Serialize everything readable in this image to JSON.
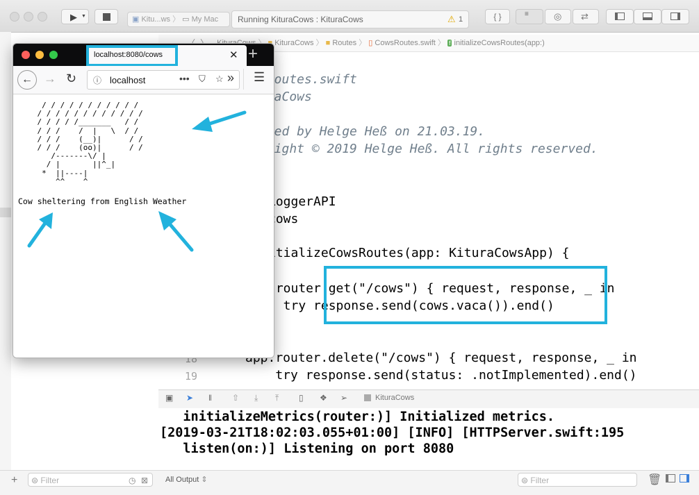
{
  "toolbar": {
    "scheme_target": "Kitu...ws",
    "scheme_device": "My Mac",
    "activity_text": "Running KituraCows : KituraCows",
    "warning_count": "1"
  },
  "jumpbar": {
    "crumbs": [
      "KituraCows",
      "KituraCows",
      "Routes",
      "CowsRoutes.swift",
      "initializeCowsRoutes(app:)"
    ]
  },
  "editor": {
    "lines": [
      {
        "num": "",
        "text": "sRoutes.swift"
      },
      {
        "num": "",
        "text": "uraCows"
      },
      {
        "num": "",
        "text": "ated by Helge Heß on 21.03.19."
      },
      {
        "num": "",
        "text": "yright © 2019 Helge Heß. All rights reserved."
      },
      {
        "num": "",
        "text": "LoggerAPI"
      },
      {
        "num": "",
        "text": "cows"
      },
      {
        "num": "",
        "text": "itializeCowsRoutes(app: KituraCowsApp) {"
      },
      {
        "num": "",
        "text": ".router.get(\"/cows\") { request, response, _ in"
      },
      {
        "num": "",
        "text": "  try response.send(cows.vaca()).end()"
      },
      {
        "num": "18",
        "text": "app.router.delete(\"/cows\") { request, response, _ in"
      },
      {
        "num": "19",
        "text": "    try response.send(status: .notImplemented).end()"
      }
    ]
  },
  "debug": {
    "target": "KituraCows"
  },
  "console": {
    "lines": [
      "   initializeMetrics(router:)] Initialized metrics.",
      "[2019-03-21T18:02:03.055+01:00] [INFO] [HTTPServer.swift:195",
      "   listen(on:)] Listening on port 8080"
    ]
  },
  "bottom": {
    "filter_placeholder": "Filter",
    "output_selector": "All Output",
    "filter_placeholder_right": "Filter"
  },
  "browser": {
    "tab_title": "localhost:8080/cows",
    "url_text": "localhost",
    "ascii_art": "     / / / / / / / / / / /\n    / / / / / / / / / / / /\n    / / / / /_______   / /\n    / / /    /  |   \\  / /\n    / / /    (__)|      / /\n    / / /    (oo)|      / /\n       /-------\\/ |\n      / |       ||^_|\n     *  ||----|\n        ^^    ^",
    "caption": "Cow sheltering from English Weather"
  },
  "colors": {
    "highlight": "#22b2dd",
    "keyword": "#9b2393",
    "string": "#c41a16",
    "comment": "#707f8c"
  }
}
